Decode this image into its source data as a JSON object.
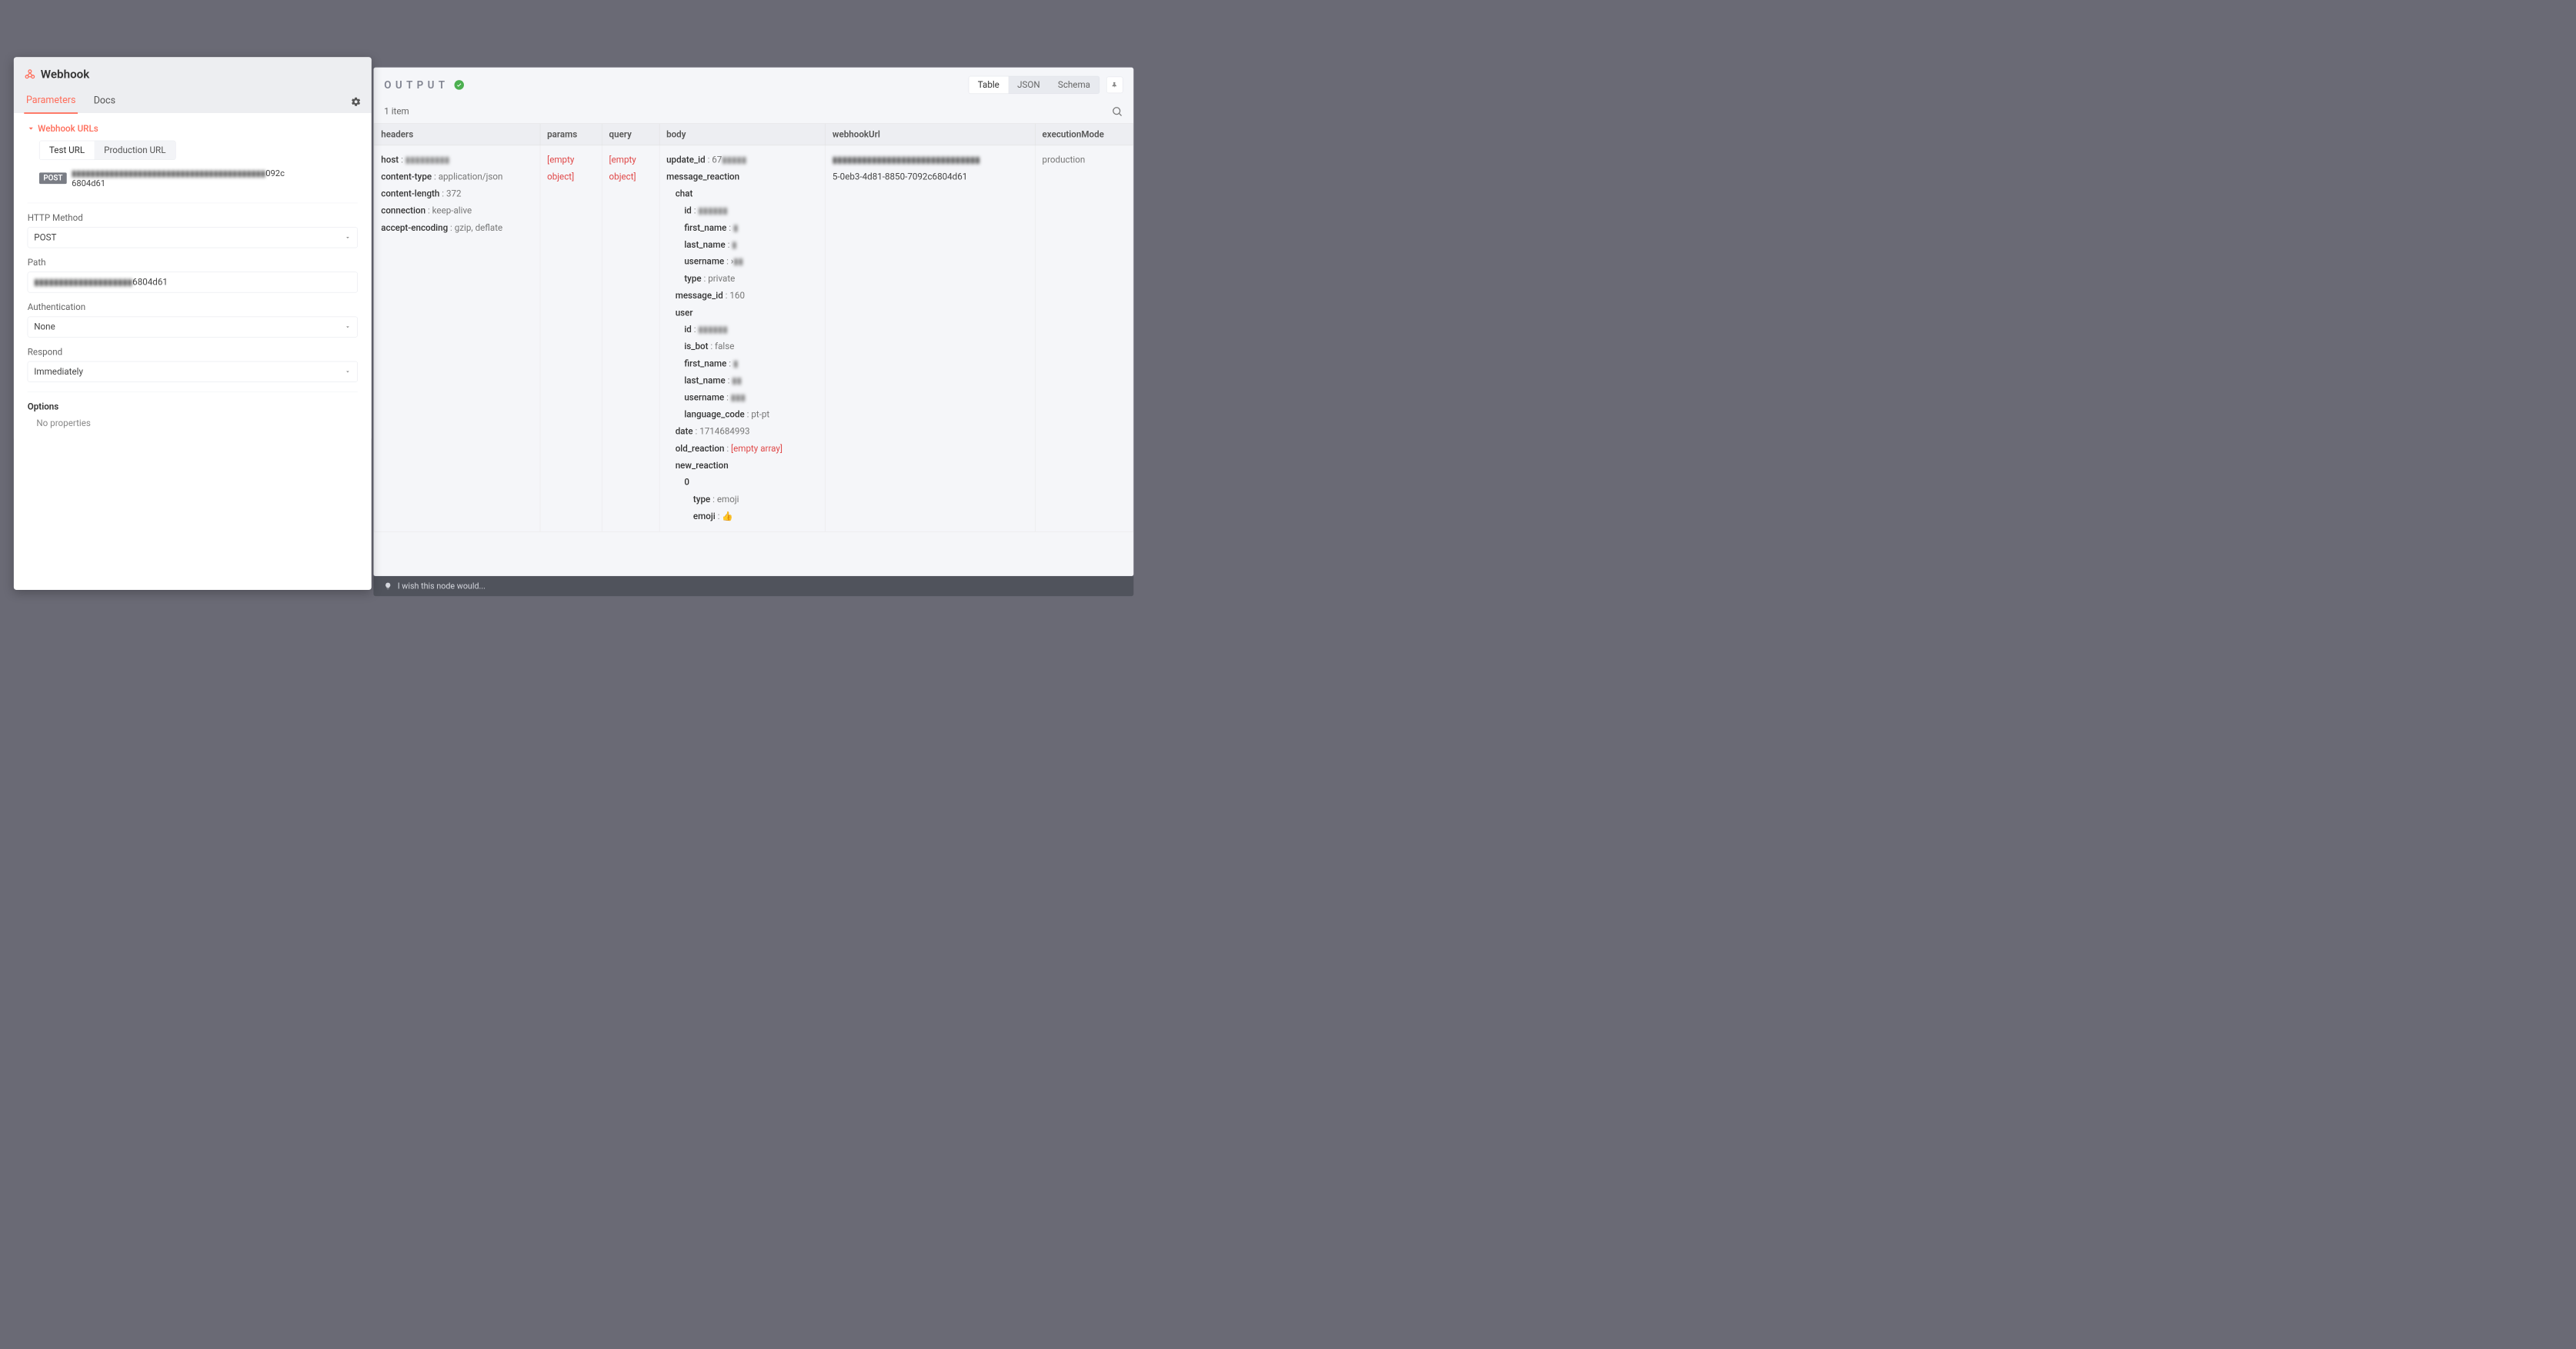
{
  "left_panel": {
    "title": "Webhook",
    "tabs": {
      "parameters": "Parameters",
      "docs": "Docs"
    },
    "active_tab": "parameters",
    "section_webhook_urls": "Webhook URLs",
    "url_toggle": {
      "test": "Test URL",
      "production": "Production URL",
      "active": "test"
    },
    "method_chip": "POST",
    "url_obscured": "▮▮▮▮▮▮▮▮▮▮▮▮▮▮▮▮▮▮▮▮▮▮▮▮▮▮▮▮▮▮▮▮▮▮▮▮▮▮▮▮▮",
    "url_suffix1": "092c",
    "url_suffix2": "6804d61",
    "fields": {
      "http_method": {
        "label": "HTTP Method",
        "value": "POST"
      },
      "path": {
        "label": "Path",
        "value_obscured": "▮▮▮▮▮▮▮▮▮▮▮▮▮▮▮▮▮▮▮▮",
        "value_suffix": "6804d61"
      },
      "authentication": {
        "label": "Authentication",
        "value": "None"
      },
      "respond": {
        "label": "Respond",
        "value": "Immediately"
      }
    },
    "options_label": "Options",
    "options_empty": "No properties"
  },
  "output": {
    "title": "OUTPUT",
    "views": {
      "table": "Table",
      "json": "JSON",
      "schema": "Schema",
      "active": "table"
    },
    "item_count": "1 item",
    "columns": {
      "headers": "headers",
      "params": "params",
      "query": "query",
      "body": "body",
      "webhookUrl": "webhookUrl",
      "executionMode": "executionMode"
    },
    "row": {
      "headers": {
        "host": {
          "k": "host",
          "v_obscured": "▮▮▮▮▮▮▮▮▮"
        },
        "content_type": {
          "k": "content-type",
          "v": "application/json"
        },
        "content_length": {
          "k": "content-length",
          "v": "372"
        },
        "connection": {
          "k": "connection",
          "v": "keep-alive"
        },
        "accept_encoding": {
          "k": "accept-encoding",
          "v": "gzip, deflate"
        }
      },
      "params": "[empty object]",
      "query": "[empty object]",
      "body": {
        "update_id": {
          "k": "update_id",
          "v_prefix": "67",
          "v_obscured": "▮▮▮▮▮"
        },
        "message_reaction": "message_reaction",
        "chat": "chat",
        "chat_id": {
          "k": "id",
          "v_obscured": "▮▮▮▮▮▮"
        },
        "chat_first_name": {
          "k": "first_name",
          "v_obscured": "▮"
        },
        "chat_last_name": {
          "k": "last_name",
          "v_obscured": "▮"
        },
        "chat_username": {
          "k": "username",
          "v_prefix": "›",
          "v_obscured": "▮▮"
        },
        "chat_type": {
          "k": "type",
          "v": "private"
        },
        "message_id": {
          "k": "message_id",
          "v": "160"
        },
        "user": "user",
        "user_id": {
          "k": "id",
          "v_obscured": "▮▮▮▮▮▮"
        },
        "user_is_bot": {
          "k": "is_bot",
          "v": "false"
        },
        "user_first_name": {
          "k": "first_name",
          "v_obscured": "▮"
        },
        "user_last_name": {
          "k": "last_name",
          "v_obscured": "▮▮"
        },
        "user_username": {
          "k": "username",
          "v_obscured": "▮▮▮"
        },
        "user_language_code": {
          "k": "language_code",
          "v": "pt-pt"
        },
        "date": {
          "k": "date",
          "v": "1714684993"
        },
        "old_reaction": {
          "k": "old_reaction",
          "v_empty": "[empty array]"
        },
        "new_reaction": "new_reaction",
        "nr_index": "0",
        "nr_type": {
          "k": "type",
          "v": "emoji"
        },
        "nr_emoji": {
          "k": "emoji",
          "v": "👍"
        }
      },
      "webhookUrl": {
        "line1_obscured": "▮▮▮▮▮▮▮▮▮▮▮▮▮▮▮▮▮▮▮▮▮▮▮▮▮▮▮▮▮▮",
        "line2": "5-0eb3-4d81-8850-7092c6804d61"
      },
      "executionMode": "production"
    }
  },
  "wish_bar": "I wish this node would..."
}
